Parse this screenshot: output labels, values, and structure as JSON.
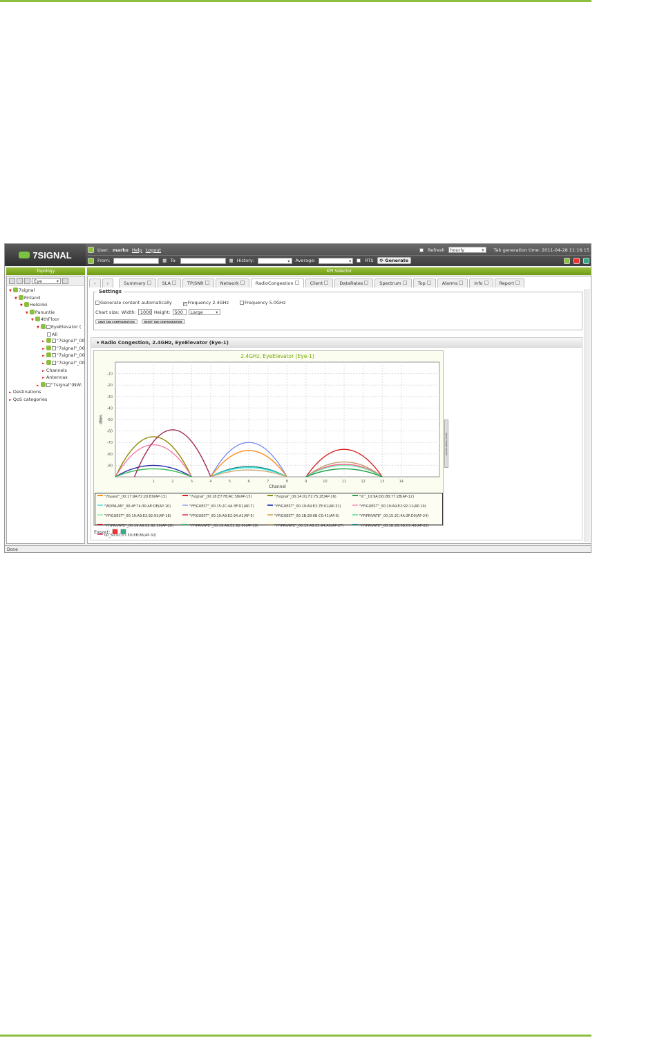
{
  "header": {
    "logo": "7SIGNAL",
    "user_label": "User:",
    "user": "marko",
    "help": "Help",
    "logout": "Logout",
    "refresh": "Refresh",
    "refresh_value": "hourly",
    "tab_generation": "Tab generation time: 2011-04-28 11:16:15",
    "from": "From:",
    "to": "To:",
    "history": "History:",
    "average": "Average:",
    "rts": "RTS",
    "generate": "Generate"
  },
  "left": {
    "title": "Topology",
    "search": "Eye",
    "tree": [
      "7signal",
      "Finland",
      "Helsinki",
      "Panuntie",
      "4thFloor",
      "EyeElevator (",
      "All",
      "\"7signal\"_00",
      "\"7signal\"_00",
      "\"7signal\"_00",
      "\"7signal\"_00",
      "Channels",
      "Antennas",
      "\"7signal\"(NW-",
      "Destinations",
      "QoS categories"
    ]
  },
  "right": {
    "title": "KPI Selector",
    "tabs": [
      "Summary",
      "SLA",
      "TP/SNR",
      "Network",
      "RadioCongestion",
      "Client",
      "DataRates",
      "Spectrum",
      "Top",
      "Alarms",
      "Info",
      "Report"
    ],
    "active_tab": "RadioCongestion"
  },
  "settings": {
    "legend": "Settings",
    "auto": "Generate content automatically",
    "auto_checked": false,
    "f24": "Frequency 2.4GHz",
    "f24_checked": true,
    "f50": "Frequency 5.0GHz",
    "f50_checked": false,
    "chart_size": "Chart size:",
    "width_label": "Width:",
    "width": "1000",
    "height_label": "Height:",
    "height": "500",
    "size": "Large",
    "save": "SAVE TAB CONFIGURATION",
    "reset": "RESET TAB CONFIGURATION"
  },
  "panel": {
    "title": "Radio Congestion, 2.4GHz, EyeElevator (Eye-1)",
    "side_tab": "SHOW CHART VALUES",
    "export": "Export:"
  },
  "status": "Done",
  "chart_data": {
    "type": "line",
    "title": "2.4GHz, EyeElevator (Eye-1)",
    "xlabel": "Channel",
    "ylabel": "dBm",
    "ylim": [
      -100,
      0
    ],
    "xlim": [
      -1,
      16
    ],
    "yticks": [
      -10,
      -20,
      -30,
      -40,
      -50,
      -60,
      -70,
      -80,
      -90
    ],
    "xticks": [
      1,
      2,
      3,
      4,
      5,
      6,
      7,
      8,
      9,
      10,
      11,
      12,
      13,
      14
    ],
    "grid": true,
    "curves": [
      {
        "channel": 1,
        "peak": -65,
        "color": "#8b8b00"
      },
      {
        "channel": 1,
        "peak": -72,
        "color": "#f27ca8"
      },
      {
        "channel": 1,
        "peak": -90,
        "color": "#2a2aa8"
      },
      {
        "channel": 1,
        "peak": -93,
        "color": "#3bbf5a"
      },
      {
        "channel": 2,
        "peak": -59,
        "color": "#a3265a"
      },
      {
        "channel": 6,
        "peak": -70,
        "color": "#7a8cf2"
      },
      {
        "channel": 6,
        "peak": -77,
        "color": "#ff8a1a"
      },
      {
        "channel": 6,
        "peak": -91,
        "color": "#168a7a"
      },
      {
        "channel": 6,
        "peak": -92,
        "color": "#33e0e0"
      },
      {
        "channel": 6,
        "peak": -94,
        "color": "#c8a870"
      },
      {
        "channel": 11,
        "peak": -76,
        "color": "#d81e1e"
      },
      {
        "channel": 11,
        "peak": -87,
        "color": "#c09868"
      },
      {
        "channel": 11,
        "peak": -89,
        "color": "#f05a8a"
      },
      {
        "channel": 11,
        "peak": -90,
        "color": "#7ae8a8"
      },
      {
        "channel": 11,
        "peak": -93,
        "color": "#20a050"
      }
    ],
    "legend": [
      {
        "name": "\"7Guest\"_00:17:9A:F2:20:B9(AP-13)",
        "color": "#ff8a1a"
      },
      {
        "name": "\"7signal\"_00:18:E7:FB:AC:58(AP-15)",
        "color": "#d81e1e"
      },
      {
        "name": "\"7signal\"_00:24:01:F2:75:2E(AP-16)",
        "color": "#8b8b00"
      },
      {
        "name": "\"IC\"_10:9A:DD:8B:77:2B(AP-12)",
        "color": "#20a050"
      },
      {
        "name": "\"WDWLAN\"_00:4F:74:30:AE:DE(AP-10)",
        "color": "#7ae8e8"
      },
      {
        "name": "\"YFIGUEST\"_00:15:2C:4A:3F:D1(AP-7)",
        "color": "#b0b8f0"
      },
      {
        "name": "\"YFIGUEST\"_00:19:A9:E2:7E:61(AP-31)",
        "color": "#4050c0"
      },
      {
        "name": "\"YFIGUEST\"_00:19:A9:E2:92:11(AP-19)",
        "color": "#f8a8c8"
      },
      {
        "name": "\"YFIGUEST\"_00:19:A9:E2:92:91(AP-18)",
        "color": "#a8f0b8"
      },
      {
        "name": "\"YFIGUEST\"_00:19:A9:E2:94:A1(AP-5)",
        "color": "#f05a8a"
      },
      {
        "name": "\"YFIGUEST\"_00:1B:28:6B:C0:41(AP-6)",
        "color": "#d8b880"
      },
      {
        "name": "\"YFIPRIVATE\"_00:15:2C:4A:3F:D0(AP-24)",
        "color": "#7ae8a8"
      },
      {
        "name": "\"YFIPRIVATE\"_00:19:A9:E2:92:10(AP-28)",
        "color": "#c02020"
      },
      {
        "name": "\"YFIPRIVATE\"_00:19:A9:E2:92:90(AP-28)",
        "color": "#30c060"
      },
      {
        "name": "\"YFIPRIVATE\"_00:19:A9:E2:94:A0(AP-27)",
        "color": "#c0a060"
      },
      {
        "name": "\"YFIPRIVATE\"_00:1B:2B:6B:C0:40(AP-22)",
        "color": "#168a8a"
      },
      {
        "name": "00_5B:8C:27:5D:8B:86(AP-32)",
        "color": "#e06080"
      }
    ]
  }
}
